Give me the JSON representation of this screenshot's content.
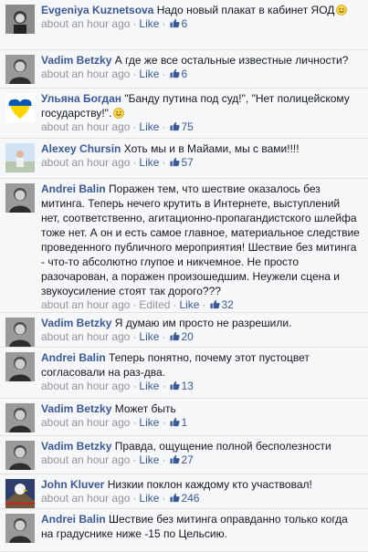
{
  "comments": [
    {
      "author": "Evgeniya Kuznetsova",
      "text": "Надо новый плакат в кабинет ЯОД",
      "emoji": true,
      "time": "about an hour ago",
      "edited": "",
      "like_label": "Like",
      "likes": "6"
    },
    {
      "author": "Vadim Betzky",
      "text": "А где же все остальные известные личности?",
      "emoji": false,
      "time": "about an hour ago",
      "edited": "",
      "like_label": "Like",
      "likes": "6"
    },
    {
      "author": "Ульяна Богдан",
      "text": "\"Банду путина под суд!\", \"Нет полицейскому государству!\".",
      "emoji": true,
      "time": "about an hour ago",
      "edited": "",
      "like_label": "Like",
      "likes": "75"
    },
    {
      "author": "Alexey Chursin",
      "text": "Хоть мы и в Майами, мы с вами!!!!",
      "emoji": false,
      "time": "about an hour ago",
      "edited": "",
      "like_label": "Like",
      "likes": "57"
    },
    {
      "author": "Andrei Balin",
      "text": "Поражен тем, что шествие оказалось без митинга. Теперь нечего крутить в Интернете, выступлений нет, соответственно, агитационно-пропагандистского шлейфа тоже нет. А он и есть самое главное, материальное следствие проведенного публичного мероприятия! Шествие без митинга - что-то абсолютно глупое и никчемное. Не просто разочарован, а поражен произошедшим. Неужели сцена и звукоусиление стоят так дорого???",
      "emoji": false,
      "time": "about an hour ago",
      "edited": "Edited",
      "like_label": "Like",
      "likes": "32"
    },
    {
      "author": "Vadim Betzky",
      "text": "Я думаю им просто не разрешили.",
      "emoji": false,
      "time": "about an hour ago",
      "edited": "",
      "like_label": "Like",
      "likes": "20"
    },
    {
      "author": "Andrei Balin",
      "text": "Теперь понятно, почему этот пустоцвет согласовали на раз-два.",
      "emoji": false,
      "time": "about an hour ago",
      "edited": "",
      "like_label": "Like",
      "likes": "13"
    },
    {
      "author": "Vadim Betzky",
      "text": "Может быть",
      "emoji": false,
      "time": "about an hour ago",
      "edited": "",
      "like_label": "Like",
      "likes": "1"
    },
    {
      "author": "Vadim Betzky",
      "text": "Правда, ощущение полной бесполезности",
      "emoji": false,
      "time": "about an hour ago",
      "edited": "",
      "like_label": "Like",
      "likes": "27"
    },
    {
      "author": "John Kluver",
      "text": "Низкии поклон каждому кто участвовал!",
      "emoji": false,
      "time": "about an hour ago",
      "edited": "",
      "like_label": "Like",
      "likes": "246"
    },
    {
      "author": "Andrei Balin",
      "text": "Шествие без митинга оправданно только когда на градуснике ниже -15 по Цельсию.",
      "emoji": false,
      "time": "",
      "edited": "",
      "like_label": "",
      "likes": ""
    }
  ],
  "colors": {
    "link": "#3b5998",
    "meta": "#90949c",
    "background": "#f6f7f9"
  }
}
